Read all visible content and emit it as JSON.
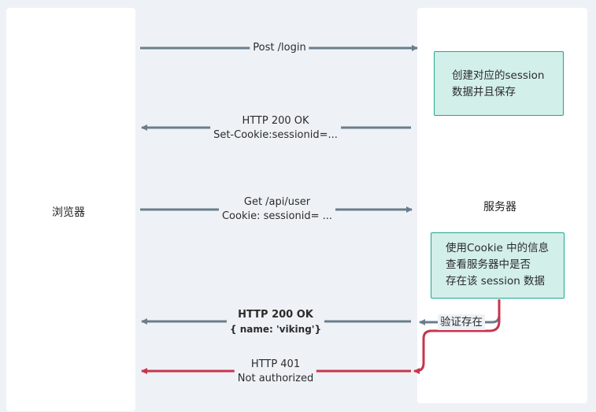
{
  "participants": {
    "browser": "浏览器",
    "server": "服务器"
  },
  "messages": [
    {
      "lines": [
        "Post /login"
      ],
      "bold": false,
      "direction": "right",
      "color": "#6b7d8c"
    },
    {
      "lines": [
        "HTTP 200 OK",
        "Set-Cookie:sessionid=..."
      ],
      "bold": false,
      "direction": "left",
      "color": "#6b7d8c"
    },
    {
      "lines": [
        "Get /api/user",
        "Cookie: sessionid= ..."
      ],
      "bold": false,
      "direction": "right",
      "color": "#6b7d8c"
    },
    {
      "lines": [
        "HTTP 200 OK",
        "{ name: 'viking'}"
      ],
      "bold": true,
      "direction": "left",
      "color": "#6b7d8c"
    },
    {
      "lines": [
        "HTTP 401",
        "Not authorized"
      ],
      "bold": false,
      "direction": "left",
      "color": "#c8354e"
    }
  ],
  "notes": {
    "create_session": [
      "创建对应的session",
      "数据并且保存"
    ],
    "check_session": [
      "使用Cookie 中的信息",
      "查看服务器中是否",
      "存在该 session 数据"
    ]
  },
  "verify_label": "验证存在",
  "colors": {
    "arrow_gray": "#6b7d8c",
    "arrow_red": "#c8354e",
    "note_fill": "#d2efea",
    "note_border": "#1fa68f"
  }
}
